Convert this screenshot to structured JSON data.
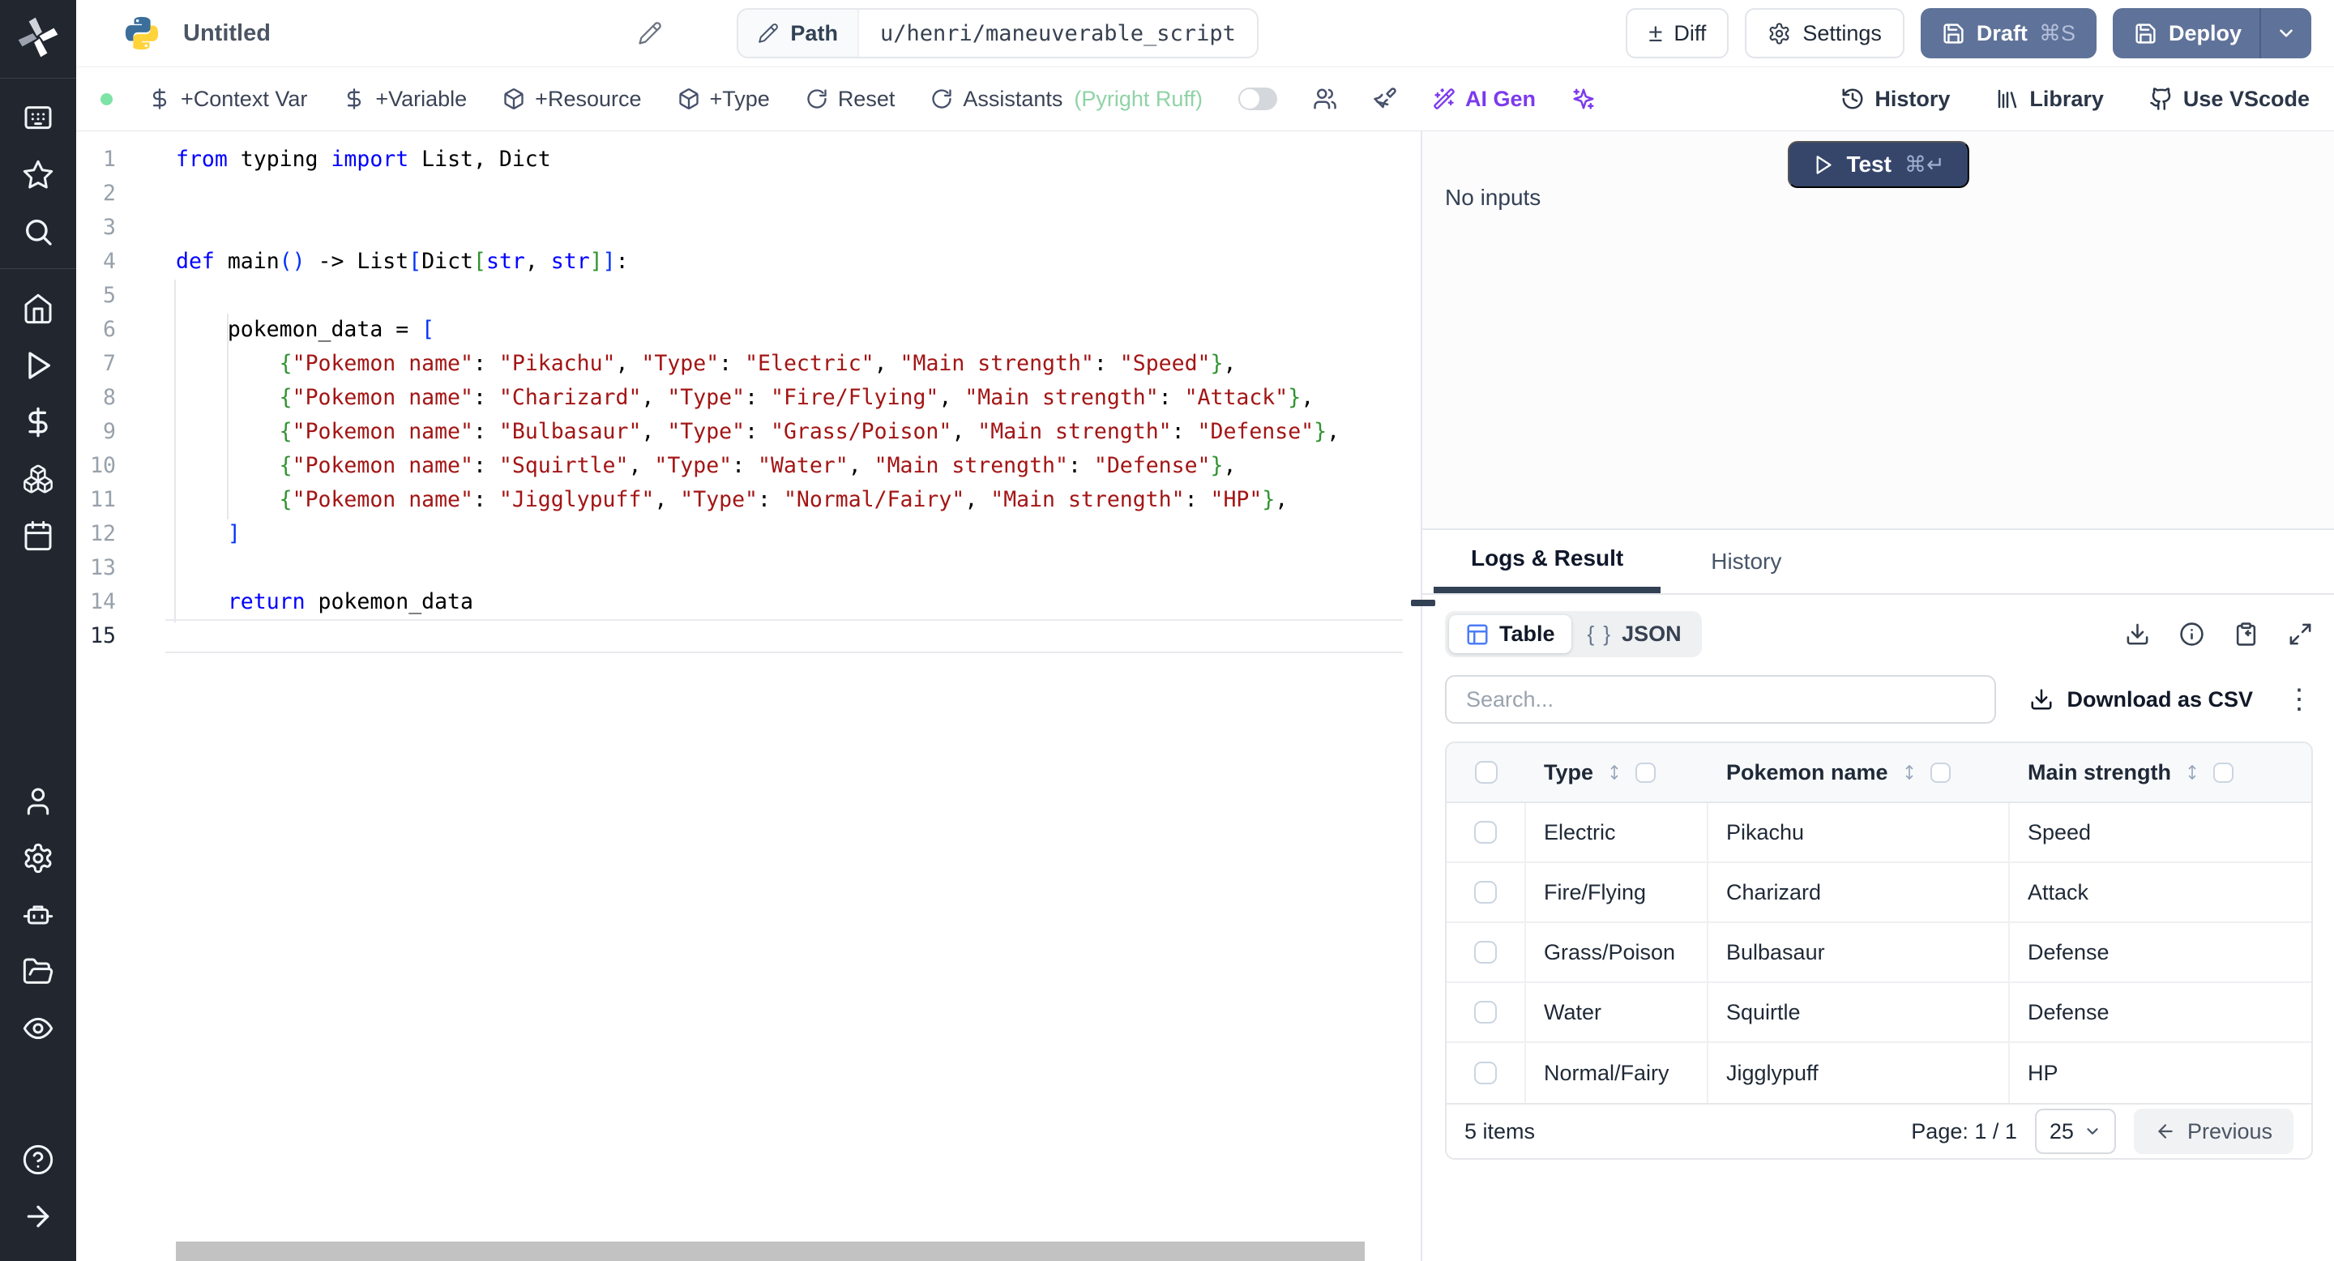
{
  "header": {
    "title": "Untitled",
    "path_label": "Path",
    "path_value": "u/henri/maneuverable_script",
    "diff": "Diff",
    "diff_glyph": "±",
    "settings": "Settings",
    "draft": "Draft",
    "draft_shortcut": "⌘S",
    "deploy": "Deploy"
  },
  "toolbar": {
    "context_var": "+Context Var",
    "variable": "+Variable",
    "resource": "+Resource",
    "type": "+Type",
    "reset": "Reset",
    "assistants": "Assistants",
    "assistants_detail": "(Pyright Ruff)",
    "ai_gen": "AI Gen",
    "history": "History",
    "library": "Library",
    "vscode": "Use VScode"
  },
  "sidebar": {
    "top": [
      "app-grid",
      "star",
      "search"
    ],
    "mid": [
      "home",
      "play",
      "dollar",
      "boxes",
      "calendar"
    ],
    "bottom": [
      "user",
      "cog",
      "bot",
      "folder",
      "eye"
    ],
    "footer": [
      "help",
      "arrow-right"
    ]
  },
  "editor": {
    "current_line": 15,
    "lines": [
      {
        "segs": [
          [
            "k",
            "from"
          ],
          [
            "t",
            " typing "
          ],
          [
            "k",
            "import"
          ],
          [
            "t",
            " List, Dict"
          ]
        ]
      },
      {
        "segs": []
      },
      {
        "segs": []
      },
      {
        "segs": [
          [
            "k",
            "def"
          ],
          [
            "t",
            " main"
          ],
          [
            "b1",
            "()"
          ],
          [
            "t",
            " -> List"
          ],
          [
            "b1",
            "["
          ],
          [
            "t",
            "Dict"
          ],
          [
            "b2",
            "["
          ],
          [
            "k",
            "str"
          ],
          [
            "t",
            ", "
          ],
          [
            "k",
            "str"
          ],
          [
            "b2",
            "]"
          ],
          [
            "b1",
            "]"
          ],
          [
            "t",
            ":"
          ]
        ]
      },
      {
        "segs": []
      },
      {
        "segs": [
          [
            "t",
            "    pokemon_data = "
          ],
          [
            "b1",
            "["
          ]
        ]
      },
      {
        "segs": [
          [
            "t",
            "        "
          ],
          [
            "b2",
            "{"
          ],
          [
            "s",
            "\"Pokemon name\""
          ],
          [
            "t",
            ": "
          ],
          [
            "s",
            "\"Pikachu\""
          ],
          [
            "t",
            ", "
          ],
          [
            "s",
            "\"Type\""
          ],
          [
            "t",
            ": "
          ],
          [
            "s",
            "\"Electric\""
          ],
          [
            "t",
            ", "
          ],
          [
            "s",
            "\"Main strength\""
          ],
          [
            "t",
            ": "
          ],
          [
            "s",
            "\"Speed\""
          ],
          [
            "b2",
            "}"
          ],
          [
            "t",
            ","
          ]
        ]
      },
      {
        "segs": [
          [
            "t",
            "        "
          ],
          [
            "b2",
            "{"
          ],
          [
            "s",
            "\"Pokemon name\""
          ],
          [
            "t",
            ": "
          ],
          [
            "s",
            "\"Charizard\""
          ],
          [
            "t",
            ", "
          ],
          [
            "s",
            "\"Type\""
          ],
          [
            "t",
            ": "
          ],
          [
            "s",
            "\"Fire/Flying\""
          ],
          [
            "t",
            ", "
          ],
          [
            "s",
            "\"Main strength\""
          ],
          [
            "t",
            ": "
          ],
          [
            "s",
            "\"Attack\""
          ],
          [
            "b2",
            "}"
          ],
          [
            "t",
            ","
          ]
        ]
      },
      {
        "segs": [
          [
            "t",
            "        "
          ],
          [
            "b2",
            "{"
          ],
          [
            "s",
            "\"Pokemon name\""
          ],
          [
            "t",
            ": "
          ],
          [
            "s",
            "\"Bulbasaur\""
          ],
          [
            "t",
            ", "
          ],
          [
            "s",
            "\"Type\""
          ],
          [
            "t",
            ": "
          ],
          [
            "s",
            "\"Grass/Poison\""
          ],
          [
            "t",
            ", "
          ],
          [
            "s",
            "\"Main strength\""
          ],
          [
            "t",
            ": "
          ],
          [
            "s",
            "\"Defense\""
          ],
          [
            "b2",
            "}"
          ],
          [
            "t",
            ","
          ]
        ]
      },
      {
        "segs": [
          [
            "t",
            "        "
          ],
          [
            "b2",
            "{"
          ],
          [
            "s",
            "\"Pokemon name\""
          ],
          [
            "t",
            ": "
          ],
          [
            "s",
            "\"Squirtle\""
          ],
          [
            "t",
            ", "
          ],
          [
            "s",
            "\"Type\""
          ],
          [
            "t",
            ": "
          ],
          [
            "s",
            "\"Water\""
          ],
          [
            "t",
            ", "
          ],
          [
            "s",
            "\"Main strength\""
          ],
          [
            "t",
            ": "
          ],
          [
            "s",
            "\"Defense\""
          ],
          [
            "b2",
            "}"
          ],
          [
            "t",
            ","
          ]
        ]
      },
      {
        "segs": [
          [
            "t",
            "        "
          ],
          [
            "b2",
            "{"
          ],
          [
            "s",
            "\"Pokemon name\""
          ],
          [
            "t",
            ": "
          ],
          [
            "s",
            "\"Jigglypuff\""
          ],
          [
            "t",
            ", "
          ],
          [
            "s",
            "\"Type\""
          ],
          [
            "t",
            ": "
          ],
          [
            "s",
            "\"Normal/Fairy\""
          ],
          [
            "t",
            ", "
          ],
          [
            "s",
            "\"Main strength\""
          ],
          [
            "t",
            ": "
          ],
          [
            "s",
            "\"HP\""
          ],
          [
            "b2",
            "}"
          ],
          [
            "t",
            ","
          ]
        ]
      },
      {
        "segs": [
          [
            "t",
            "    "
          ],
          [
            "b1",
            "]"
          ]
        ]
      },
      {
        "segs": []
      },
      {
        "segs": [
          [
            "t",
            "    "
          ],
          [
            "k",
            "return"
          ],
          [
            "t",
            " pokemon_data"
          ]
        ]
      },
      {
        "segs": []
      }
    ]
  },
  "run_panel": {
    "test": "Test",
    "test_shortcut": "⌘↵",
    "no_inputs": "No inputs"
  },
  "result_panel": {
    "tab_logs": "Logs & Result",
    "tab_history": "History",
    "view_table": "Table",
    "view_json": "JSON",
    "json_glyph": "{ }",
    "search_placeholder": "Search...",
    "download_csv": "Download as CSV",
    "kebab_glyph": "⋮",
    "table": {
      "columns": [
        "Type",
        "Pokemon name",
        "Main strength"
      ],
      "rows": [
        [
          "Electric",
          "Pikachu",
          "Speed"
        ],
        [
          "Fire/Flying",
          "Charizard",
          "Attack"
        ],
        [
          "Grass/Poison",
          "Bulbasaur",
          "Defense"
        ],
        [
          "Water",
          "Squirtle",
          "Defense"
        ],
        [
          "Normal/Fairy",
          "Jigglypuff",
          "HP"
        ]
      ]
    },
    "footer": {
      "items": "5 items",
      "page": "Page: 1 / 1",
      "page_size": "25",
      "previous": "Previous"
    }
  },
  "colors": {
    "accent_slate": "#5f7299",
    "test_navy": "#36466b",
    "ai_purple": "#7c3aed",
    "assistant_green": "#8fd3a6",
    "table_icon_blue": "#4b7cf7",
    "keyword_blue": "#0000ff",
    "string_red": "#a31515"
  }
}
